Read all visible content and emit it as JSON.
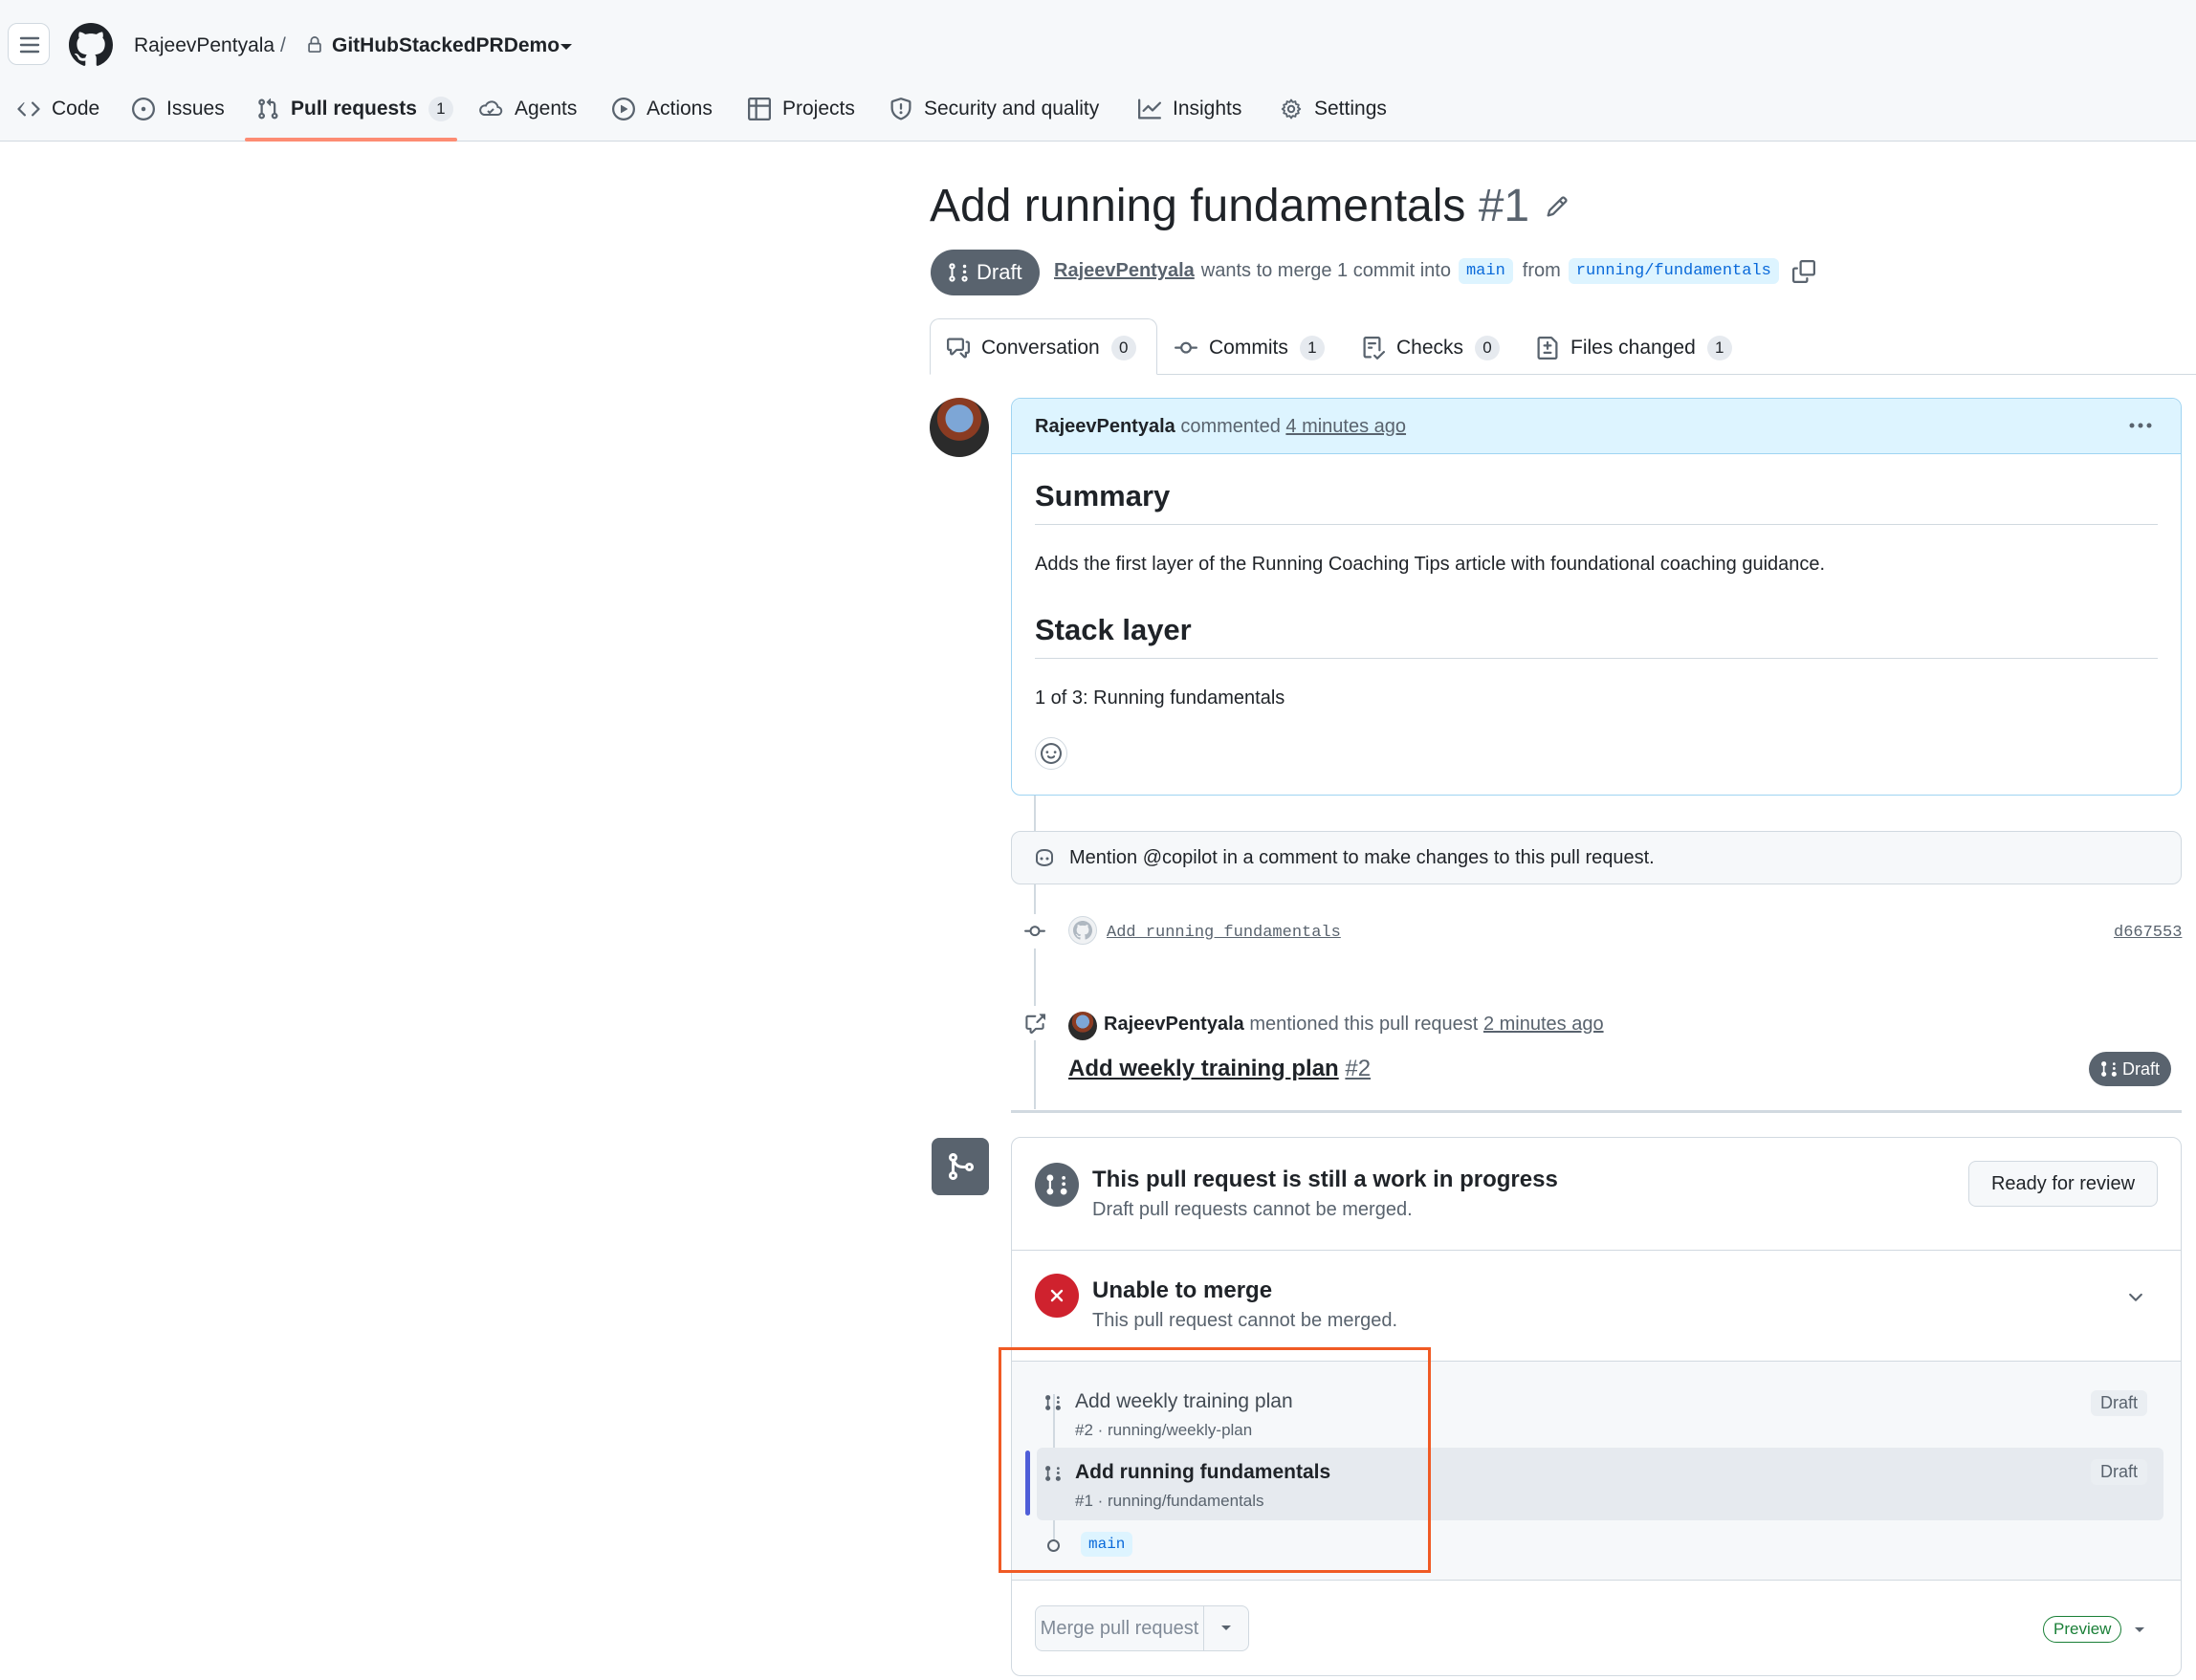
{
  "header": {
    "owner": "RajeevPentyala",
    "separator": "/",
    "repo": "GitHubStackedPRDemo",
    "nav": [
      {
        "label": "Code",
        "icon": "code-icon"
      },
      {
        "label": "Issues",
        "icon": "issue-icon"
      },
      {
        "label": "Pull requests",
        "icon": "pull-request-icon",
        "count": "1"
      },
      {
        "label": "Agents",
        "icon": "agent-icon"
      },
      {
        "label": "Actions",
        "icon": "play-icon"
      },
      {
        "label": "Projects",
        "icon": "table-icon"
      },
      {
        "label": "Security and quality",
        "icon": "shield-icon"
      },
      {
        "label": "Insights",
        "icon": "graph-icon"
      },
      {
        "label": "Settings",
        "icon": "gear-icon"
      }
    ]
  },
  "pr": {
    "title": "Add running fundamentals",
    "number": "#1",
    "state": "Draft",
    "author": "RajeevPentyala",
    "merge_text": "wants to merge 1 commit into",
    "base": "main",
    "from_text": "from",
    "head": "running/fundamentals"
  },
  "tabs": [
    {
      "label": "Conversation",
      "count": "0"
    },
    {
      "label": "Commits",
      "count": "1"
    },
    {
      "label": "Checks",
      "count": "0"
    },
    {
      "label": "Files changed",
      "count": "1"
    }
  ],
  "comment": {
    "author": "RajeevPentyala",
    "action": "commented",
    "time": "4 minutes ago",
    "h1": "Summary",
    "p1": "Adds the first layer of the Running Coaching Tips article with foundational coaching guidance.",
    "h2": "Stack layer",
    "p2": "1 of 3: Running fundamentals"
  },
  "copilot": {
    "text": "Mention @copilot in a comment to make changes to this pull request."
  },
  "commit": {
    "message": "Add running fundamentals",
    "sha": "d667553"
  },
  "mention": {
    "author": "RajeevPentyala",
    "action": "mentioned this pull request",
    "time": "2 minutes ago",
    "pr_title": "Add weekly training plan",
    "pr_number": "#2",
    "state": "Draft"
  },
  "merge_box": {
    "wip_title": "This pull request is still a work in progress",
    "wip_sub": "Draft pull requests cannot be merged.",
    "ready_button": "Ready for review",
    "unable_title": "Unable to merge",
    "unable_sub": "This pull request cannot be merged.",
    "stack": [
      {
        "title": "Add weekly training plan",
        "sub": "#2 · running/weekly-plan",
        "state": "Draft"
      },
      {
        "title": "Add running fundamentals",
        "sub": "#1 · running/fundamentals",
        "state": "Draft"
      }
    ],
    "stack_base": "main",
    "merge_button": "Merge pull request",
    "preview": "Preview"
  },
  "colors": {
    "accent": "#0969da",
    "highlight": "#f05a24",
    "danger": "#cf222e",
    "stack_bar": "#4f5ed8",
    "draft": "#59636e"
  }
}
